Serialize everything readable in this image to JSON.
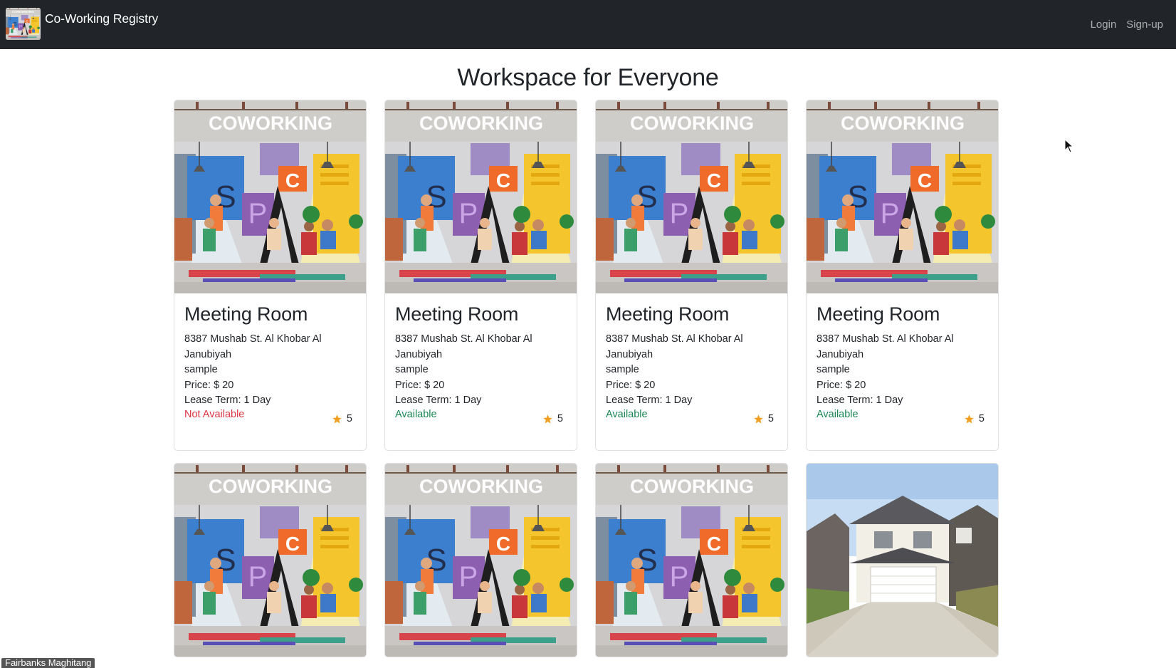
{
  "navbar": {
    "brand": "Co-Working Registry",
    "links": [
      "Login",
      "Sign-up"
    ]
  },
  "main": {
    "title": "Workspace for Everyone",
    "cards": [
      {
        "title": "Meeting Room",
        "address": "8387 Mushab St. Al Khobar Al Janubiyah",
        "description": "sample",
        "price": "Price: $ 20",
        "lease": "Lease Term: 1 Day",
        "status": "Not Available",
        "rating": "5",
        "image": "coworking-space-illustration"
      },
      {
        "title": "Meeting Room",
        "address": "8387 Mushab St. Al Khobar Al Janubiyah",
        "description": "sample",
        "price": "Price: $ 20",
        "lease": "Lease Term: 1 Day",
        "status": "Available",
        "rating": "5",
        "image": "coworking-space-illustration"
      },
      {
        "title": "Meeting Room",
        "address": "8387 Mushab St. Al Khobar Al Janubiyah",
        "description": "sample",
        "price": "Price: $ 20",
        "lease": "Lease Term: 1 Day",
        "status": "Available",
        "rating": "5",
        "image": "coworking-space-illustration"
      },
      {
        "title": "Meeting Room",
        "address": "8387 Mushab St. Al Khobar Al Janubiyah",
        "description": "sample",
        "price": "Price: $ 20",
        "lease": "Lease Term: 1 Day",
        "status": "Available",
        "rating": "5",
        "image": "coworking-space-illustration"
      },
      {
        "image": "coworking-space-illustration"
      },
      {
        "image": "coworking-space-illustration"
      },
      {
        "image": "coworking-space-illustration"
      },
      {
        "image": "house-photo"
      }
    ]
  },
  "overlay": {
    "participant_name": "Fairbanks Maghitang"
  },
  "colors": {
    "navbar": "#212529",
    "available": "#198754",
    "not_available": "#dc3545",
    "star": "#f0a020"
  }
}
